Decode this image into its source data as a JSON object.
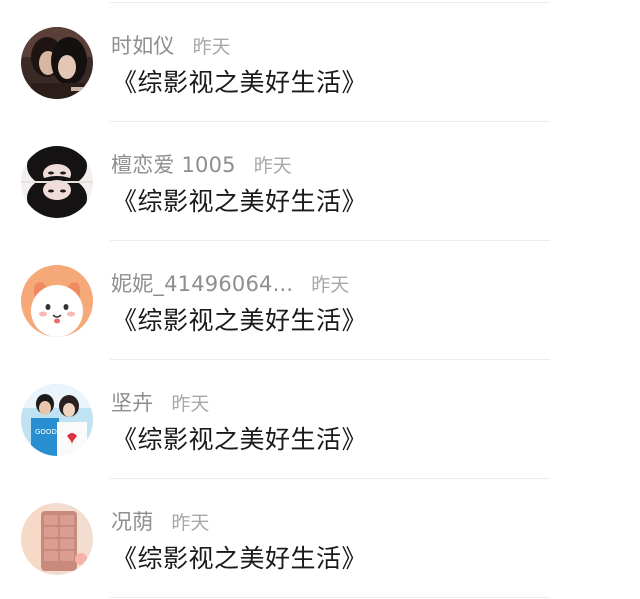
{
  "comments": [
    {
      "name": "时如仪",
      "time": "昨天",
      "text": "《综影视之美好生活》",
      "avatar": "avatar-dark-anime-couple"
    },
    {
      "name": "檀恋爱 1005",
      "time": "昨天",
      "text": "《综影视之美好生活》",
      "avatar": "avatar-reflected-girl"
    },
    {
      "name": "妮妮_41496064...",
      "time": "昨天",
      "text": "《综影视之美好生活》",
      "avatar": "avatar-cartoon-dog"
    },
    {
      "name": "坚卉",
      "time": "昨天",
      "text": "《综影视之美好生活》",
      "avatar": "avatar-couple-photo"
    },
    {
      "name": "况荫",
      "time": "昨天",
      "text": "《综影视之美好生活》",
      "avatar": "avatar-chocolate-phone"
    }
  ],
  "colors": {
    "name": "#8e8e8e",
    "time": "#a8a8a8",
    "text": "#1a1a1a",
    "divider": "#ececec"
  }
}
